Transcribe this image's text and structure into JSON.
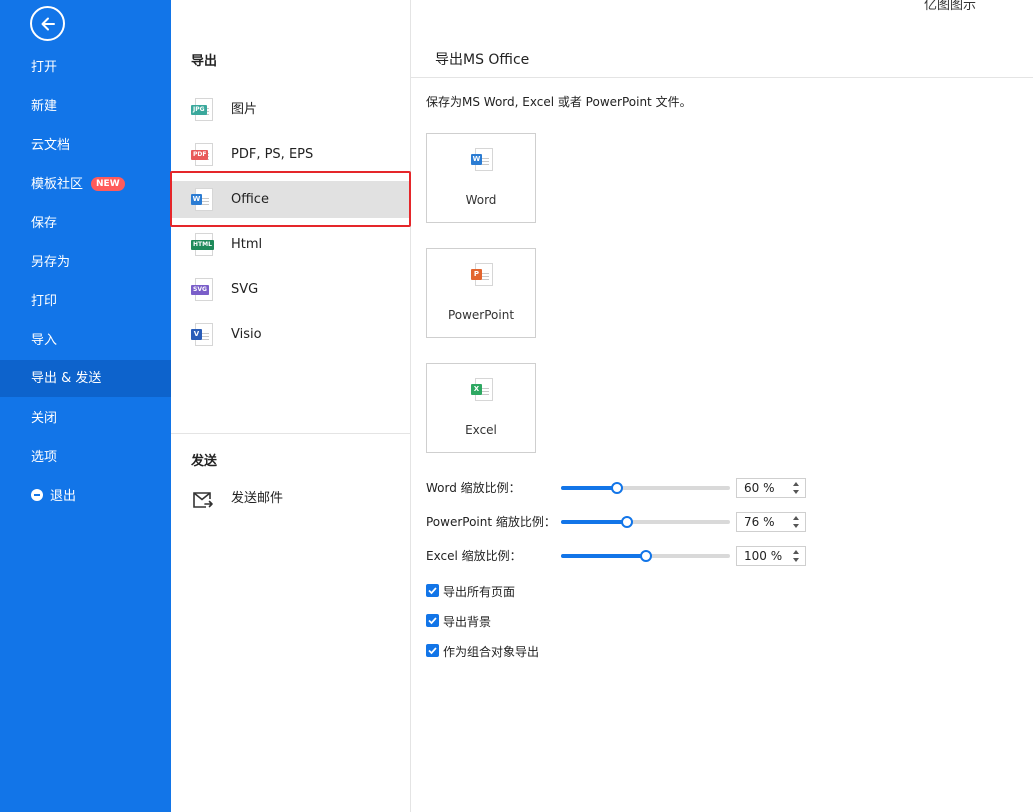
{
  "app_name": "亿图图示",
  "sidebar": {
    "back_icon": "arrow-left-icon",
    "items": [
      {
        "label": "打开"
      },
      {
        "label": "新建"
      },
      {
        "label": "云文档"
      },
      {
        "label": "模板社区",
        "badge": "NEW"
      },
      {
        "label": "保存"
      },
      {
        "label": "另存为"
      },
      {
        "label": "打印"
      },
      {
        "label": "导入"
      },
      {
        "label": "导出 & 发送",
        "active": true
      },
      {
        "label": "关闭"
      },
      {
        "label": "选项"
      },
      {
        "label": "退出",
        "icon": "minus-circle-icon"
      }
    ],
    "colors": {
      "background": "#1275e8",
      "active": "#0d63cc",
      "badge": "#ff5b5b"
    }
  },
  "export_section": {
    "title": "导出",
    "items": [
      {
        "label": "图片",
        "icon_tag": "JPG",
        "icon_color": "#3aa89c"
      },
      {
        "label": "PDF, PS, EPS",
        "icon_tag": "PDF",
        "icon_color": "#e85a5a"
      },
      {
        "label": "Office",
        "icon_tag": "W",
        "icon_color": "#2b7cd3",
        "selected": true
      },
      {
        "label": "Html",
        "icon_tag": "HTML",
        "icon_color": "#1f8a5a"
      },
      {
        "label": "SVG",
        "icon_tag": "SVG",
        "icon_color": "#7a5ec9"
      },
      {
        "label": "Visio",
        "icon_tag": "V",
        "icon_color": "#2a5db8"
      }
    ]
  },
  "send_section": {
    "title": "发送",
    "items": [
      {
        "label": "发送邮件",
        "icon": "mail-icon"
      }
    ]
  },
  "content": {
    "title": "导出MS Office",
    "description": "保存为MS Word, Excel 或者 PowerPoint 文件。",
    "formats": [
      {
        "label": "Word",
        "icon_tag": "W",
        "icon_color": "#2b7cd3"
      },
      {
        "label": "PowerPoint",
        "icon_tag": "P",
        "icon_color": "#e3652f"
      },
      {
        "label": "Excel",
        "icon_tag": "X",
        "icon_color": "#2ea862"
      }
    ],
    "zoom": [
      {
        "label": "Word 缩放比例：",
        "value_text": "60 %",
        "level": 0.33
      },
      {
        "label": "PowerPoint 缩放比例：",
        "value_text": "76 %",
        "level": 0.39
      },
      {
        "label": "Excel 缩放比例：",
        "value_text": "100 %",
        "level": 0.5
      }
    ],
    "options": [
      {
        "label": "导出所有页面",
        "checked": true
      },
      {
        "label": "导出背景",
        "checked": true
      },
      {
        "label": "作为组合对象导出",
        "checked": true
      }
    ],
    "accent_color": "#1275e8"
  }
}
